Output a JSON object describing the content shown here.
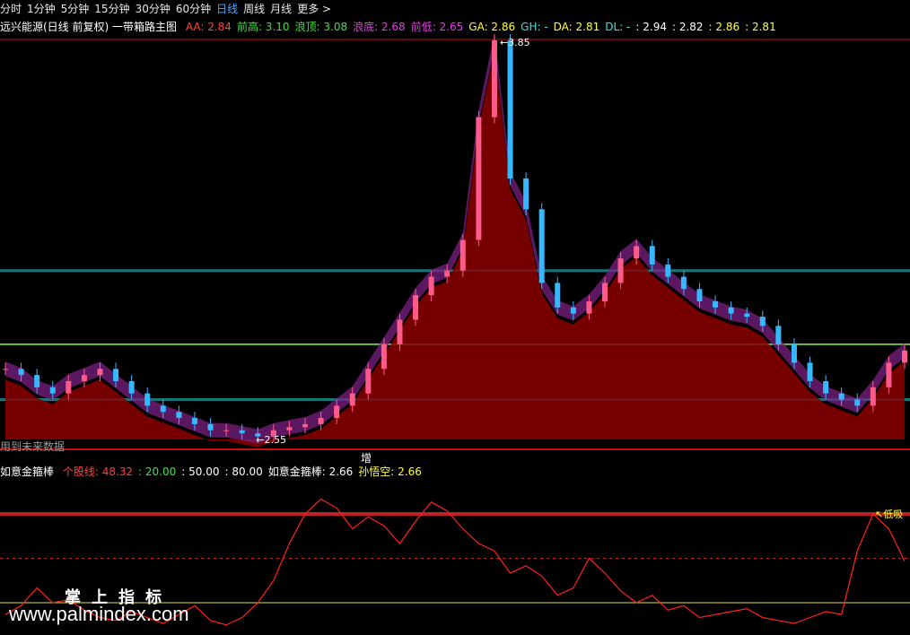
{
  "toolbar": {
    "items": [
      "分时",
      "1分钟",
      "5分钟",
      "15分钟",
      "30分钟",
      "60分钟",
      "日线",
      "周线",
      "月线",
      "更多 >"
    ],
    "active_index": 6
  },
  "main_header": {
    "title": "远兴能源(日线 前复权) 一带箱路主图",
    "indicators": [
      {
        "label": "AA: 2.84",
        "color": "#ff4040"
      },
      {
        "label": "前高: 3.10",
        "color": "#40e040"
      },
      {
        "label": "浪顶: 3.08",
        "color": "#40e040"
      },
      {
        "label": "浪底: 2.68",
        "color": "#e040e0"
      },
      {
        "label": "前低: 2.65",
        "color": "#e040e0"
      },
      {
        "label": "GA: 2.86",
        "color": "#ffff40"
      },
      {
        "label": "GH: -",
        "color": "#40e0e0"
      },
      {
        "label": "DA: 2.81",
        "color": "#ffff40"
      },
      {
        "label": "DL: -",
        "color": "#40e0e0"
      },
      {
        "label": ": 2.94",
        "color": "#ffffff"
      },
      {
        "label": ": 2.82",
        "color": "#ffffff"
      },
      {
        "label": ": 2.86",
        "color": "#ffff40"
      },
      {
        "label": ": 2.81",
        "color": "#ffff40"
      }
    ]
  },
  "annotations": {
    "high_label": "3.85",
    "low_label": "2.55",
    "future_data": "用到未来数据",
    "zeng": "增",
    "low_buy": "低吸"
  },
  "sub_header": {
    "title": "如意金箍棒",
    "items": [
      {
        "label": "个股线: 48.32",
        "color": "#ff4040"
      },
      {
        "label": ": 20.00",
        "color": "#40e040"
      },
      {
        "label": ": 50.00",
        "color": "#ffffff"
      },
      {
        "label": ": 80.00",
        "color": "#ffffff"
      },
      {
        "label": "如意金箍棒: 2.66",
        "color": "#ffffff"
      },
      {
        "label": "孙悟空: 2.66",
        "color": "#ffff40"
      }
    ]
  },
  "watermark": {
    "line1": "掌上指标",
    "line2": "www.palmindex.com"
  },
  "colors": {
    "bg": "#000000",
    "up": "#ff5a8a",
    "down": "#35b8ff",
    "band_fill_up": "#7a2080",
    "band_fill_down": "#3a8a8a",
    "area": "#8b0000",
    "level_teal": "#147878",
    "level_green": "#80ff40"
  },
  "chart_data": {
    "type": "candlestick",
    "price_range": [
      2.55,
      3.85
    ],
    "key_levels": [
      3.1,
      2.86,
      2.68
    ],
    "close_series": [
      2.78,
      2.76,
      2.72,
      2.7,
      2.74,
      2.76,
      2.78,
      2.74,
      2.7,
      2.66,
      2.64,
      2.62,
      2.6,
      2.58,
      2.58,
      2.57,
      2.56,
      2.58,
      2.59,
      2.6,
      2.62,
      2.66,
      2.7,
      2.78,
      2.86,
      2.94,
      3.02,
      3.08,
      3.1,
      3.2,
      3.6,
      3.85,
      3.4,
      3.3,
      3.06,
      2.98,
      2.96,
      3.0,
      3.06,
      3.14,
      3.18,
      3.12,
      3.08,
      3.04,
      3.0,
      2.98,
      2.96,
      2.95,
      2.92,
      2.86,
      2.8,
      2.74,
      2.7,
      2.68,
      2.66,
      2.72,
      2.8,
      2.84
    ],
    "oscillator": {
      "name": "个股线",
      "last": 48.32,
      "levels": [
        20,
        50,
        80
      ],
      "values": [
        12,
        18,
        30,
        20,
        22,
        15,
        10,
        8,
        14,
        10,
        6,
        12,
        18,
        8,
        5,
        10,
        20,
        35,
        60,
        80,
        90,
        84,
        70,
        78,
        72,
        60,
        75,
        88,
        82,
        70,
        60,
        55,
        40,
        45,
        38,
        25,
        30,
        50,
        40,
        28,
        20,
        25,
        15,
        18,
        10,
        12,
        14,
        16,
        10,
        8,
        6,
        10,
        14,
        12,
        55,
        80,
        70,
        48
      ]
    }
  }
}
